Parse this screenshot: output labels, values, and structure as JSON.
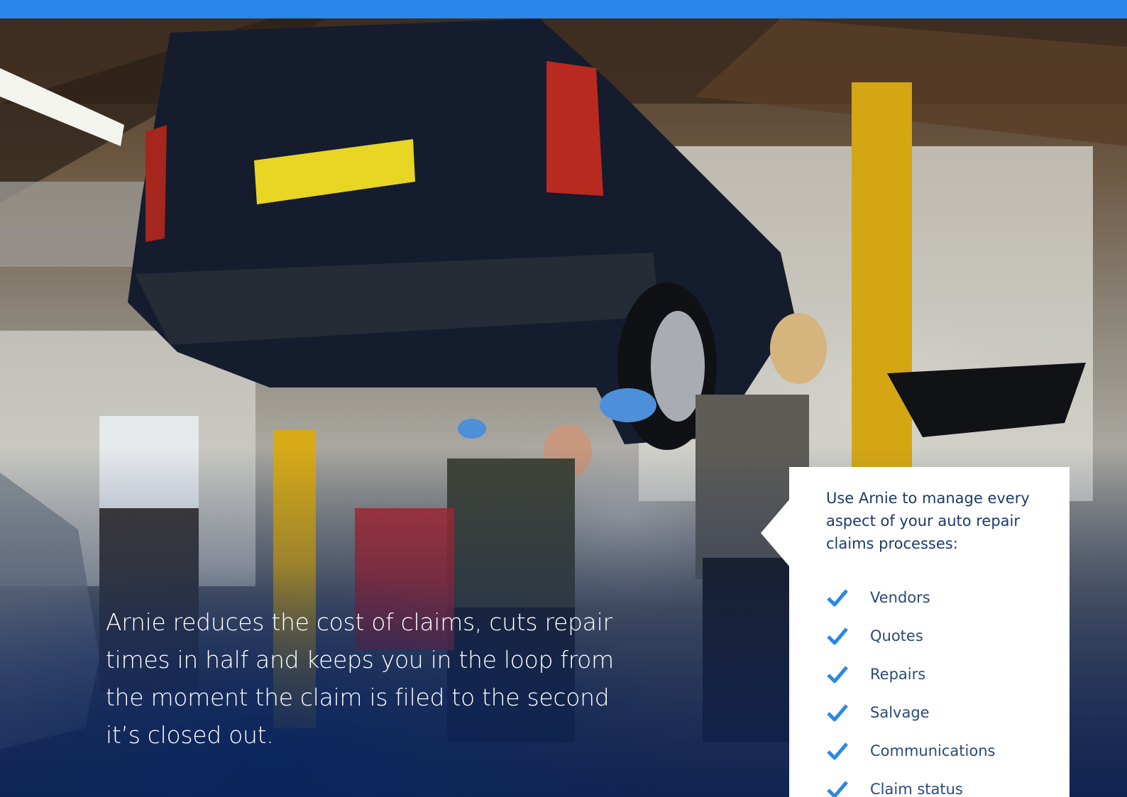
{
  "header": {
    "bar_color": "#2a87ea"
  },
  "hero": {
    "image_description_icon": "auto-repair-garage-photo",
    "caption": "Arnie reduces the cost of claims, cuts repair times in half and keeps you in the loop from the moment the claim is filed to the second it’s closed out."
  },
  "callout": {
    "intro": "Use Arnie to manage every aspect of your auto repair claims processes:",
    "check_color": "#2a87ea",
    "items": [
      {
        "label": "Vendors"
      },
      {
        "label": "Quotes"
      },
      {
        "label": "Repairs"
      },
      {
        "label": "Salvage"
      },
      {
        "label": "Communications"
      },
      {
        "label": "Claim status"
      }
    ]
  }
}
